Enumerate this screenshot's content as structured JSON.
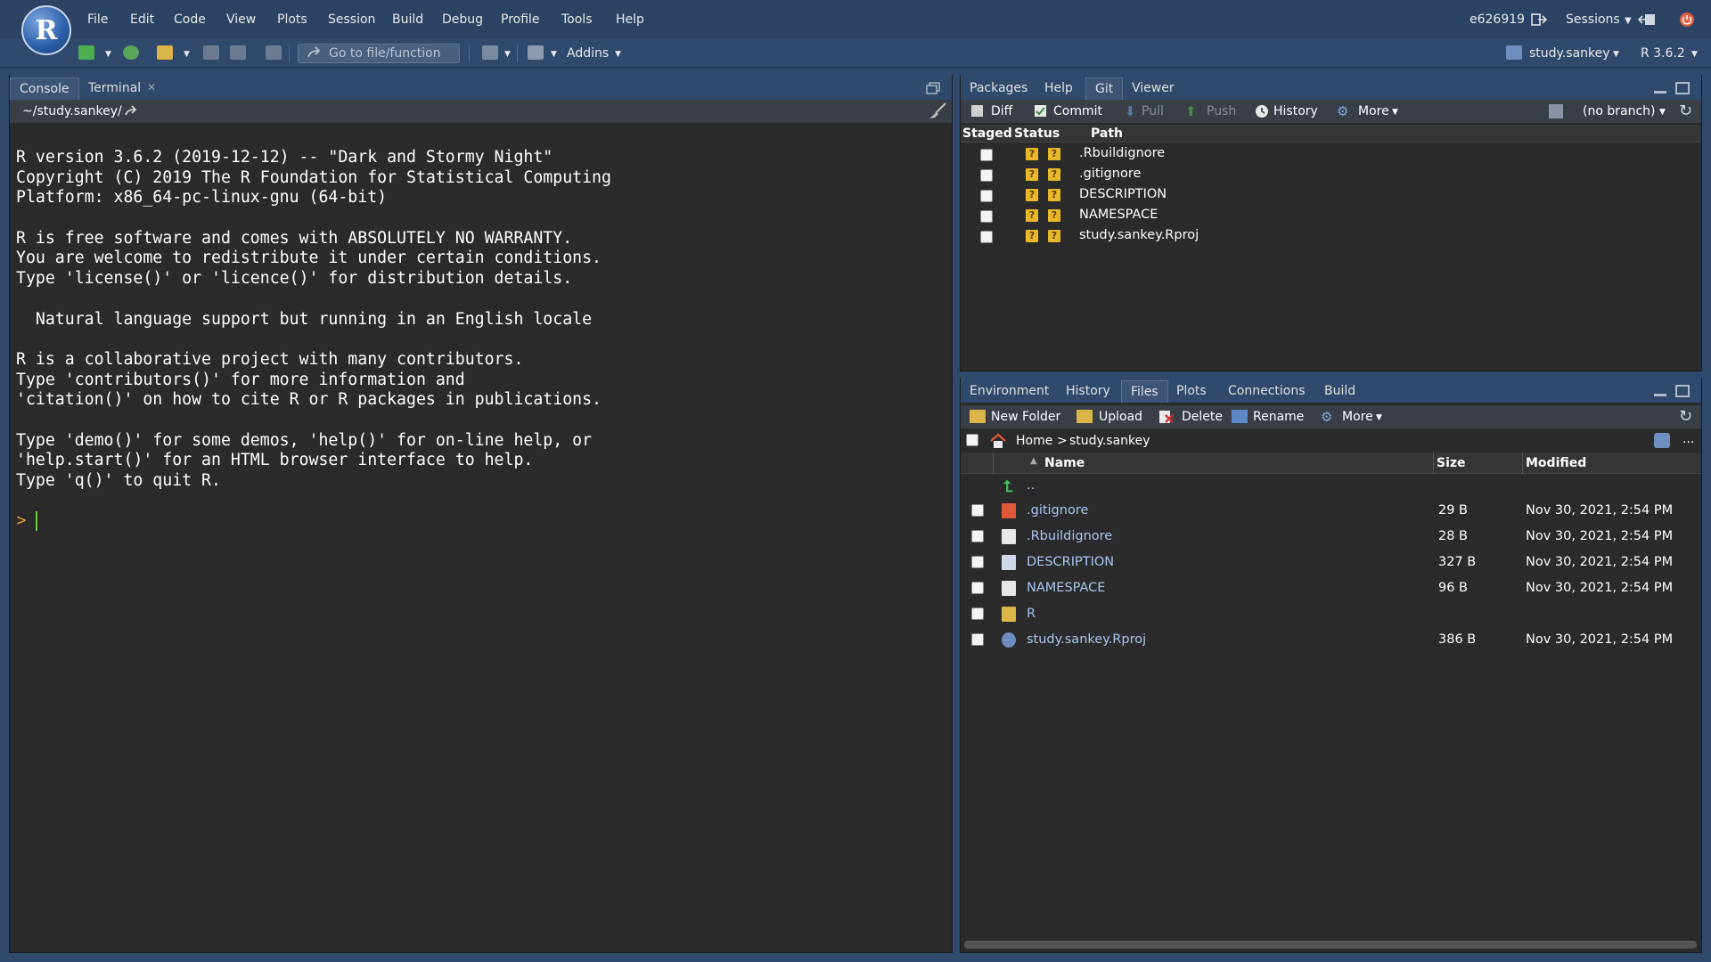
{
  "menu": {
    "items": [
      "File",
      "Edit",
      "Code",
      "View",
      "Plots",
      "Session",
      "Build",
      "Debug",
      "Profile",
      "Tools",
      "Help"
    ],
    "user": "e626919",
    "sessions": "Sessions"
  },
  "toolbar": {
    "goto_placeholder": "Go to file/function",
    "addins": "Addins",
    "project": "study.sankey",
    "r_version": "R 3.6.2"
  },
  "left": {
    "tabs": [
      "Console",
      "Terminal"
    ],
    "path": "~/study.sankey/",
    "console_lines": [
      "R version 3.6.2 (2019-12-12) -- \"Dark and Stormy Night\"",
      "Copyright (C) 2019 The R Foundation for Statistical Computing",
      "Platform: x86_64-pc-linux-gnu (64-bit)",
      "",
      "R is free software and comes with ABSOLUTELY NO WARRANTY.",
      "You are welcome to redistribute it under certain conditions.",
      "Type 'license()' or 'licence()' for distribution details.",
      "",
      "  Natural language support but running in an English locale",
      "",
      "R is a collaborative project with many contributors.",
      "Type 'contributors()' for more information and",
      "'citation()' on how to cite R or R packages in publications.",
      "",
      "Type 'demo()' for some demos, 'help()' for on-line help, or",
      "'help.start()' for an HTML browser interface to help.",
      "Type 'q()' to quit R."
    ],
    "prompt": ">"
  },
  "git": {
    "tabs": [
      "Packages",
      "Help",
      "Git",
      "Viewer"
    ],
    "toolbar": {
      "diff": "Diff",
      "commit": "Commit",
      "pull": "Pull",
      "push": "Push",
      "history": "History",
      "more": "More",
      "branch": "(no branch)"
    },
    "columns": {
      "staged": "Staged",
      "status": "Status",
      "path": "Path"
    },
    "status_glyph": "?",
    "files": [
      ".Rbuildignore",
      ".gitignore",
      "DESCRIPTION",
      "NAMESPACE",
      "study.sankey.Rproj"
    ]
  },
  "files": {
    "tabs": [
      "Environment",
      "History",
      "Files",
      "Plots",
      "Connections",
      "Build"
    ],
    "toolbar": {
      "new_folder": "New Folder",
      "upload": "Upload",
      "delete": "Delete",
      "rename": "Rename",
      "more": "More"
    },
    "breadcrumb": {
      "home": "Home",
      "sep": ">",
      "dir": "study.sankey"
    },
    "ellipsis": "...",
    "columns": {
      "name": "Name",
      "size": "Size",
      "modified": "Modified"
    },
    "parent": "..",
    "rows": [
      {
        "name": ".gitignore",
        "size": "29 B",
        "modified": "Nov 30, 2021, 2:54 PM",
        "icon": "git-file-icon"
      },
      {
        "name": ".Rbuildignore",
        "size": "28 B",
        "modified": "Nov 30, 2021, 2:54 PM",
        "icon": "text-file-icon"
      },
      {
        "name": "DESCRIPTION",
        "size": "327 B",
        "modified": "Nov 30, 2021, 2:54 PM",
        "icon": "description-file-icon"
      },
      {
        "name": "NAMESPACE",
        "size": "96 B",
        "modified": "Nov 30, 2021, 2:54 PM",
        "icon": "text-file-icon"
      },
      {
        "name": "R",
        "size": "",
        "modified": "",
        "icon": "folder-icon"
      },
      {
        "name": "study.sankey.Rproj",
        "size": "386 B",
        "modified": "Nov 30, 2021, 2:54 PM",
        "icon": "rproj-icon"
      }
    ]
  },
  "colors": {
    "accent": "#2f4a6d",
    "panel": "#2b2b2b",
    "status": "#e8b82a",
    "link": "#a9c6f0"
  }
}
